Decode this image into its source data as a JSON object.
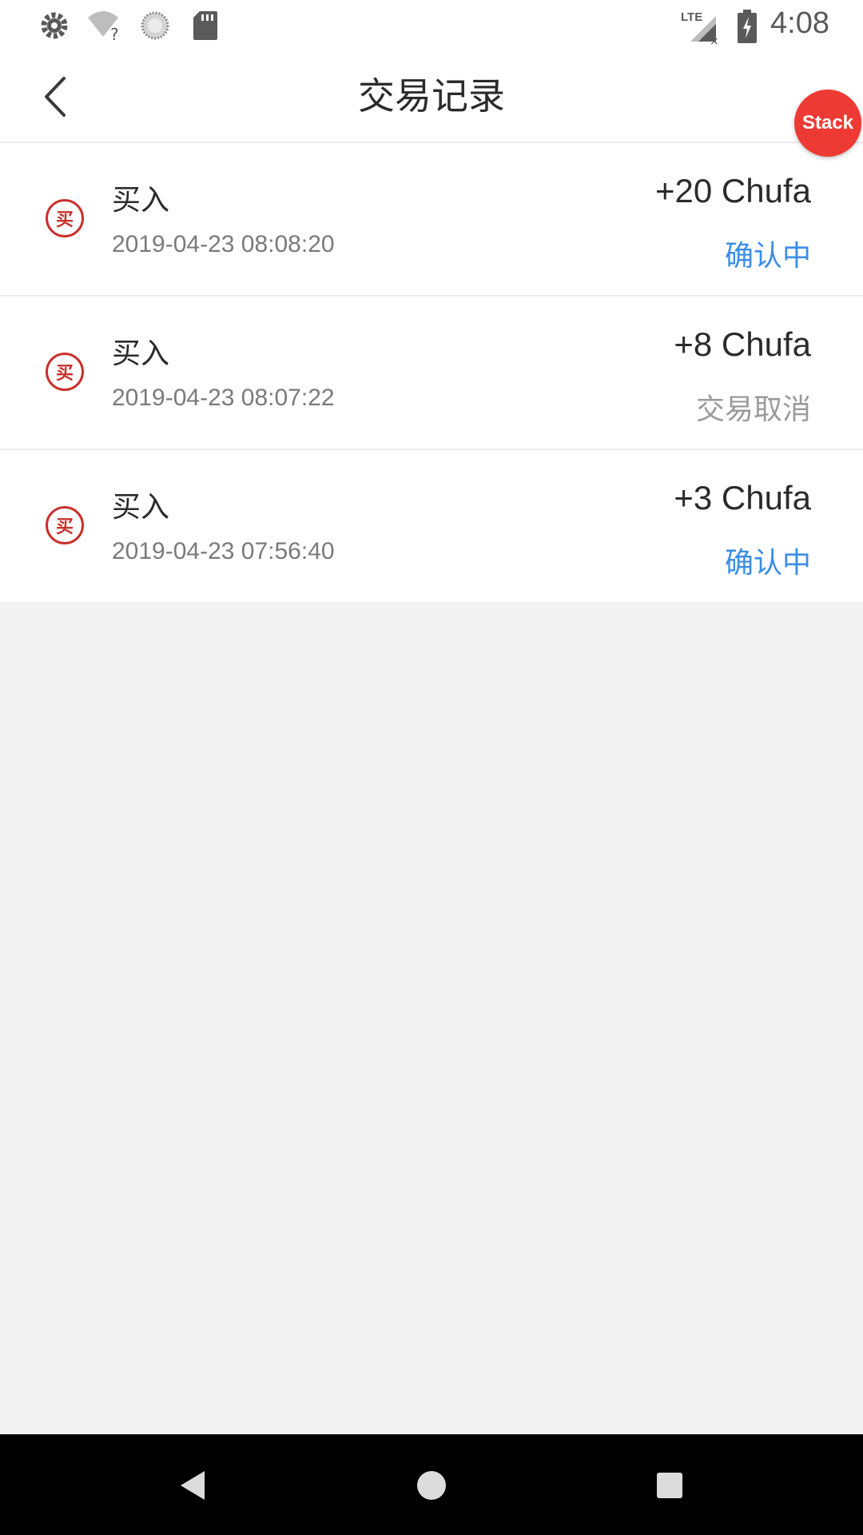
{
  "status_bar": {
    "time": "4:08",
    "left_icons": [
      "gear-icon",
      "wifi-unknown-icon",
      "sync-icon",
      "sd-card-icon"
    ],
    "right_icons": [
      "lte-signal-icon",
      "battery-charging-icon"
    ]
  },
  "header": {
    "title": "交易记录",
    "back_icon": "chevron-left-icon"
  },
  "overlay": {
    "stack_label": "Stack",
    "color": "#ee3a34"
  },
  "colors": {
    "pending": "#3a8ee6",
    "cancelled": "#9a9a9a",
    "buy_icon": "#c9302c"
  },
  "transactions": [
    {
      "type": "买入",
      "icon_char": "买",
      "time": "2019-04-23 08:08:20",
      "amount": "+20 Chufa",
      "status": "确认中",
      "status_kind": "pending"
    },
    {
      "type": "买入",
      "icon_char": "买",
      "time": "2019-04-23 08:07:22",
      "amount": "+8 Chufa",
      "status": "交易取消",
      "status_kind": "cancelled"
    },
    {
      "type": "买入",
      "icon_char": "买",
      "time": "2019-04-23 07:56:40",
      "amount": "+3 Chufa",
      "status": "确认中",
      "status_kind": "pending"
    }
  ],
  "nav_bar": {
    "buttons": [
      "back-triangle-icon",
      "home-circle-icon",
      "recents-square-icon"
    ]
  }
}
